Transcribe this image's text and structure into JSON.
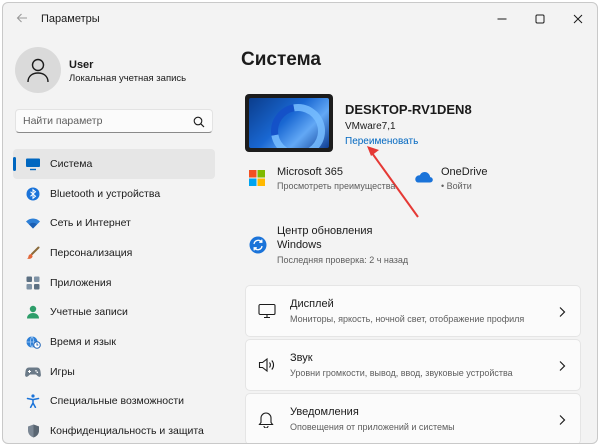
{
  "window": {
    "title": "Параметры"
  },
  "user": {
    "name": "User",
    "account": "Локальная учетная запись"
  },
  "search": {
    "placeholder": "Найти параметр"
  },
  "sidebar": {
    "items": [
      {
        "label": "Система",
        "icon": "system-monitor-icon",
        "active": true
      },
      {
        "label": "Bluetooth и устройства",
        "icon": "bluetooth-icon"
      },
      {
        "label": "Сеть и Интернет",
        "icon": "wifi-icon"
      },
      {
        "label": "Персонализация",
        "icon": "paintbrush-icon"
      },
      {
        "label": "Приложения",
        "icon": "apps-icon"
      },
      {
        "label": "Учетные записи",
        "icon": "person-icon"
      },
      {
        "label": "Время и язык",
        "icon": "globe-clock-icon"
      },
      {
        "label": "Игры",
        "icon": "gamepad-icon"
      },
      {
        "label": "Специальные возможности",
        "icon": "accessibility-icon"
      },
      {
        "label": "Конфиденциальность и защита",
        "icon": "shield-icon"
      }
    ]
  },
  "main": {
    "title": "Система",
    "device": {
      "name": "DESKTOP-RV1DEN8",
      "model": "VMware7,1",
      "rename": "Переименовать"
    },
    "tiles": {
      "ms365": {
        "title": "Microsoft 365",
        "subtitle": "Просмотреть преимущества"
      },
      "onedrive": {
        "title": "OneDrive",
        "subtitle": "• Войти"
      },
      "update": {
        "title_line1": "Центр обновления",
        "title_line2": "Windows",
        "subtitle": "Последняя проверка: 2 ч назад"
      }
    },
    "cards": [
      {
        "title": "Дисплей",
        "subtitle": "Мониторы, яркость, ночной свет, отображение профиля",
        "icon": "display-icon"
      },
      {
        "title": "Звук",
        "subtitle": "Уровни громкости, вывод, ввод, звуковые устройства",
        "icon": "speaker-icon"
      },
      {
        "title": "Уведомления",
        "subtitle": "Оповещения от приложений и системы",
        "icon": "bell-icon"
      }
    ]
  },
  "colors": {
    "accent": "#0067c0",
    "annotation_arrow": "#e53935"
  }
}
